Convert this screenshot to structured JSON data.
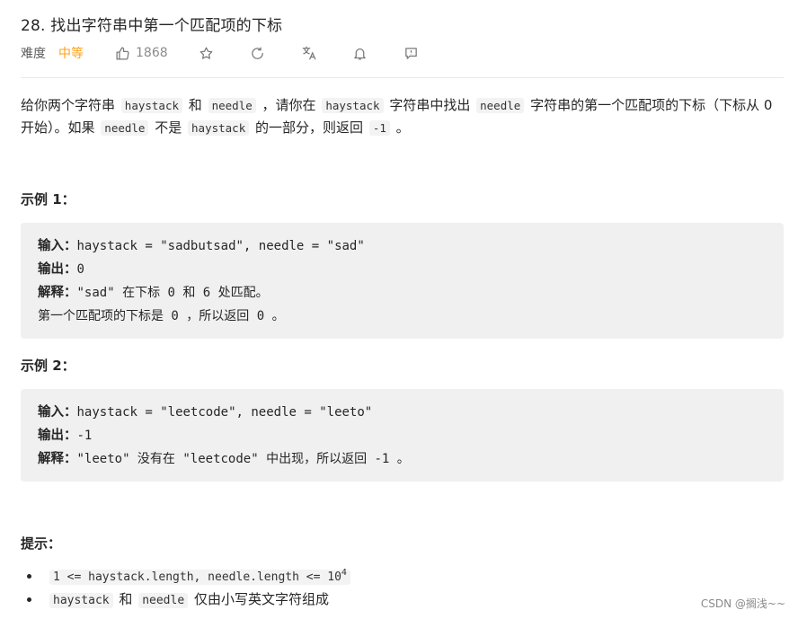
{
  "problem": {
    "title": "28. 找出字符串中第一个匹配项的下标",
    "difficulty_label": "难度",
    "difficulty": "中等",
    "likes": "1868"
  },
  "description": {
    "p1_a": "给你两个字符串",
    "p1_haystack": "haystack",
    "p1_b": "和",
    "p1_needle": "needle",
    "p1_c": "，请你在",
    "p1_haystack2": "haystack",
    "p1_d": "字符串中找出",
    "p1_needle2": "needle",
    "p1_e": "字符串的第一个匹配项的下标（下标从 0 开始）。如果",
    "p1_needle3": "needle",
    "p1_f": "不是",
    "p1_haystack3": "haystack",
    "p1_g": "的一部分，则返回",
    "p1_neg1": "-1",
    "p1_h": "。"
  },
  "examples": [
    {
      "title": "示例 1：",
      "input_label": "输入：",
      "input": "haystack = \"sadbutsad\", needle = \"sad\"",
      "output_label": "输出：",
      "output": "0",
      "explain_label": "解释：",
      "explain": "\"sad\" 在下标 0 和 6 处匹配。",
      "explain2": "第一个匹配项的下标是 0 ，所以返回 0 。"
    },
    {
      "title": "示例 2：",
      "input_label": "输入：",
      "input": "haystack = \"leetcode\", needle = \"leeto\"",
      "output_label": "输出：",
      "output": "-1",
      "explain_label": "解释：",
      "explain": "\"leeto\" 没有在 \"leetcode\" 中出现，所以返回 -1 。"
    }
  ],
  "hints": {
    "title": "提示：",
    "h1_code": "1 <= haystack.length, needle.length <= 10",
    "h1_sup": "4",
    "h2_haystack": "haystack",
    "h2_a": "和",
    "h2_needle": "needle",
    "h2_b": "仅由小写英文字符组成"
  },
  "watermark": "CSDN @搁浅~~",
  "colors": {
    "difficulty": "#ffa116",
    "code_bg": "#f0f0f0"
  },
  "icons": [
    "thumbs-up-icon",
    "star-icon",
    "share-icon",
    "translate-icon",
    "bell-icon",
    "feedback-icon"
  ]
}
